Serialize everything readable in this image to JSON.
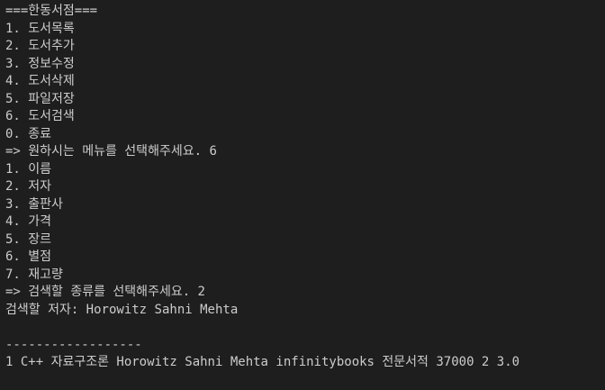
{
  "terminal": {
    "header": "===한동서점===",
    "main_menu": [
      "1. 도서목록",
      "2. 도서추가",
      "3. 정보수정",
      "4. 도서삭제",
      "5. 파일저장",
      "6. 도서검색",
      "0. 종료"
    ],
    "main_prompt": "=> 원하시는 메뉴를 선택해주세요. 6",
    "search_menu": [
      "1. 이름",
      "2. 저자",
      "3. 출판사",
      "4. 가격",
      "5. 장르",
      "6. 별점",
      "7. 재고량"
    ],
    "search_prompt": "=> 검색할 종류를 선택해주세요. 2",
    "search_input_line": "검색할 저자: Horowitz Sahni Mehta",
    "separator": "------------------",
    "result_line": "1 C++ 자료구조론 Horowitz Sahni Mehta infinitybooks 전문서적 37000 2 3.0"
  }
}
